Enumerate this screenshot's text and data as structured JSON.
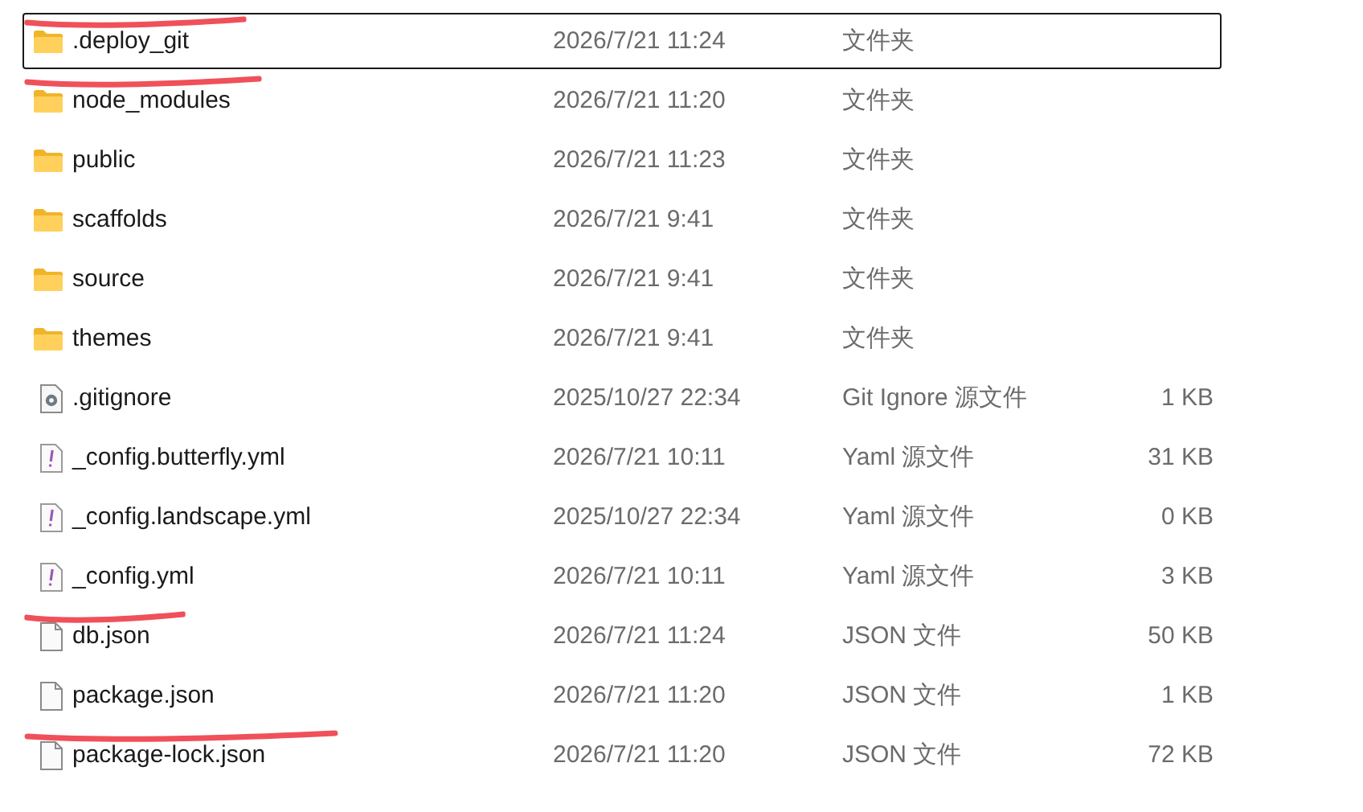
{
  "rows": [
    {
      "kind": "folder",
      "name": ".deploy_git",
      "date": "2026/7/21 11:24",
      "type": "文件夹",
      "selected": true,
      "struck": true
    },
    {
      "kind": "folder",
      "name": "node_modules",
      "date": "2026/7/21 11:20",
      "type": "文件夹",
      "selected": false,
      "struck": true
    },
    {
      "kind": "folder",
      "name": "public",
      "date": "2026/7/21 11:23",
      "type": "文件夹",
      "selected": false,
      "struck": false
    },
    {
      "kind": "folder",
      "name": "scaffolds",
      "date": "2026/7/21 9:41",
      "type": "文件夹",
      "selected": false,
      "struck": false
    },
    {
      "kind": "folder",
      "name": "source",
      "date": "2026/7/21 9:41",
      "type": "文件夹",
      "selected": false,
      "struck": false
    },
    {
      "kind": "folder",
      "name": "themes",
      "date": "2026/7/21 9:41",
      "type": "文件夹",
      "selected": false,
      "struck": false
    },
    {
      "kind": "settings",
      "name": ".gitignore",
      "date": "2025/10/27 22:34",
      "type": "Git Ignore 源文件",
      "size": "1 KB",
      "selected": false,
      "struck": false
    },
    {
      "kind": "yaml",
      "name": "_config.butterfly.yml",
      "date": "2026/7/21 10:11",
      "type": "Yaml 源文件",
      "size": "31 KB",
      "selected": false,
      "struck": false
    },
    {
      "kind": "yaml",
      "name": "_config.landscape.yml",
      "date": "2025/10/27 22:34",
      "type": "Yaml 源文件",
      "size": "0 KB",
      "selected": false,
      "struck": false
    },
    {
      "kind": "yaml",
      "name": "_config.yml",
      "date": "2026/7/21 10:11",
      "type": "Yaml 源文件",
      "size": "3 KB",
      "selected": false,
      "struck": false
    },
    {
      "kind": "file",
      "name": "db.json",
      "date": "2026/7/21 11:24",
      "type": "JSON 文件",
      "size": "50 KB",
      "selected": false,
      "struck": true
    },
    {
      "kind": "file",
      "name": "package.json",
      "date": "2026/7/21 11:20",
      "type": "JSON 文件",
      "size": "1 KB",
      "selected": false,
      "struck": false
    },
    {
      "kind": "file",
      "name": "package-lock.json",
      "date": "2026/7/21 11:20",
      "type": "JSON 文件",
      "size": "72 KB",
      "selected": false,
      "struck": true
    }
  ]
}
